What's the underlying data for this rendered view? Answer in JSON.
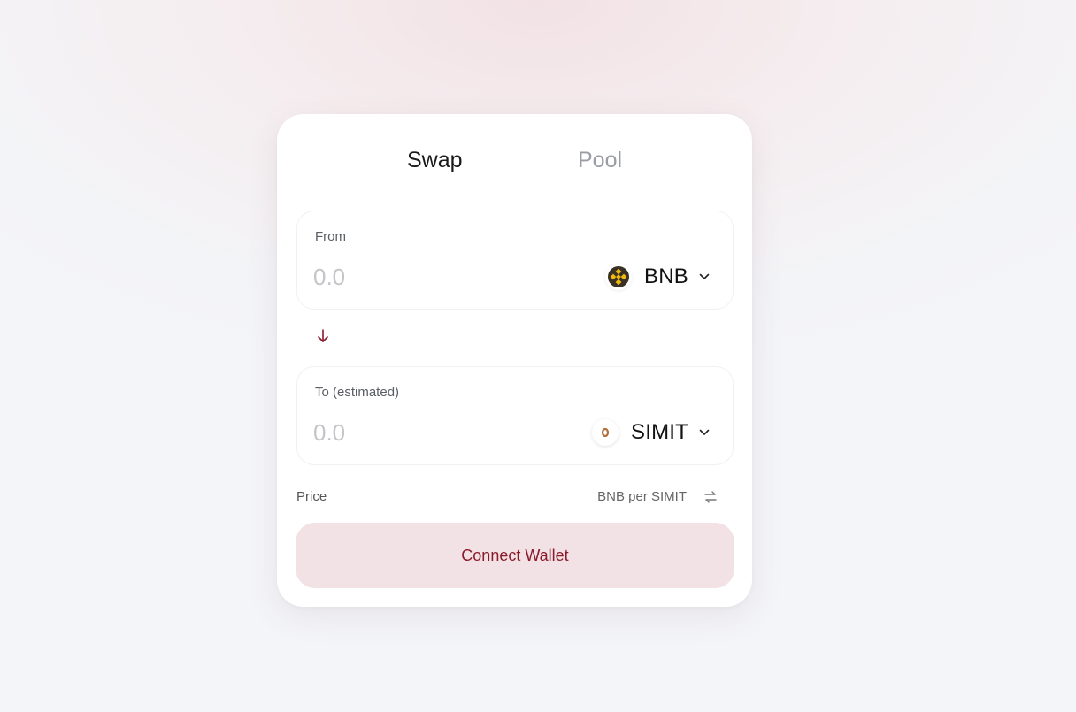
{
  "tabs": {
    "swap_label": "Swap",
    "pool_label": "Pool",
    "active": "Swap"
  },
  "from": {
    "label": "From",
    "amount_placeholder": "0.0",
    "token": "BNB",
    "token_icon": "bnb-icon"
  },
  "to": {
    "label": "To (estimated)",
    "amount_placeholder": "0.0",
    "token": "SIMIT",
    "token_icon": "simit-icon"
  },
  "price": {
    "label": "Price",
    "value": "BNB per SIMIT"
  },
  "connect_button_label": "Connect Wallet",
  "colors": {
    "accent": "#8b1a2b",
    "button_bg": "#f2e2e5",
    "bnb_gold": "#f0b90b",
    "inactive_tab": "#9a9da3",
    "placeholder": "#c3c5c9"
  }
}
